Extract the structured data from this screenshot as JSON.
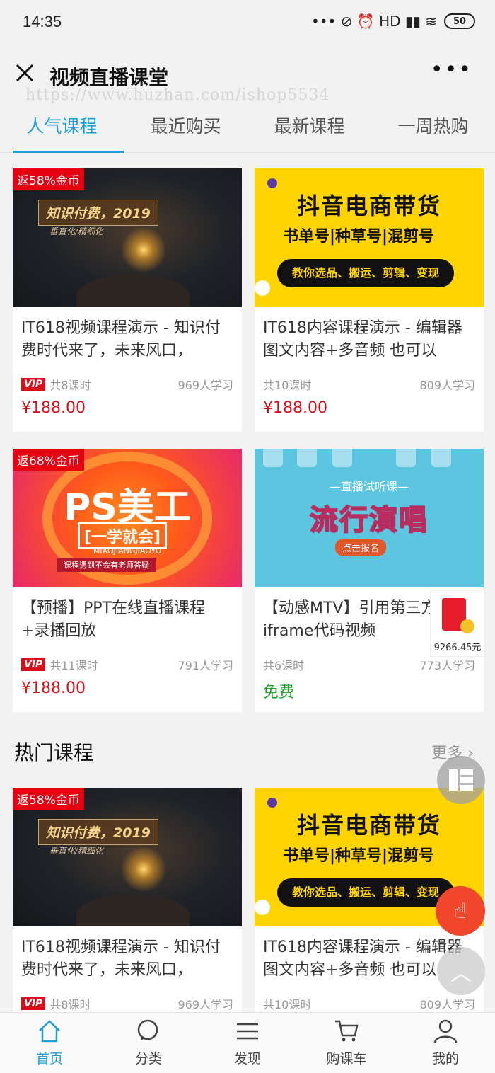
{
  "status_bar": {
    "time": "14:35",
    "icons_text": "••• ⊘ ⏰ HD ▮▮ ≋",
    "battery": "50"
  },
  "header": {
    "title": "视频直播课堂",
    "watermark": "https://www.huzhan.com/ishop5534"
  },
  "tabs": [
    {
      "label": "人气课程",
      "active": true
    },
    {
      "label": "最近购买",
      "active": false
    },
    {
      "label": "最新课程",
      "active": false
    },
    {
      "label": "一周热购",
      "active": false
    }
  ],
  "popular": [
    {
      "badge": "返58%金币",
      "thumb": {
        "banner": "知识付费，2019",
        "sub": "垂直化/精细化"
      },
      "title": "IT618视频课程演示 - 知识付费时代来了，未来风口，",
      "vip": "VIP",
      "lessons": "共8课时",
      "students": "969人学习",
      "price": "¥188.00"
    },
    {
      "badge": "",
      "thumb": {
        "line1": "抖音电商带货",
        "line2": "书单号|种草号|混剪号",
        "line3": "教你选品、搬运、剪辑、变现"
      },
      "title": "IT618内容课程演示 - 编辑器图文内容+多音频 也可以",
      "vip": "",
      "lessons": "共10课时",
      "students": "809人学习",
      "price": "¥188.00"
    },
    {
      "badge": "返68%金币",
      "thumb": {
        "line1": "PS美工",
        "line2": "[一学就会]",
        "line3": "MIAOJIANGJIAOYU",
        "line4": "课程遇到不会有老师答疑"
      },
      "title": "【预播】PPT在线直播课程+录播回放",
      "vip": "VIP",
      "lessons": "共11课时",
      "students": "791人学习",
      "price": "¥188.00"
    },
    {
      "badge": "",
      "thumb": {
        "line1": "—直播试听课—",
        "line2": "流行演唱",
        "line3": "点击报名"
      },
      "title": "【动感MTV】引用第三方通用iframe代码视频",
      "vip": "",
      "lessons": "共6课时",
      "students": "773人学习",
      "price": "免费"
    }
  ],
  "hot_section": {
    "title": "热门课程",
    "more": "更多 ›"
  },
  "hot": [
    {
      "badge": "返58%金币",
      "thumb": {
        "banner": "知识付费，2019",
        "sub": "垂直化/精细化"
      },
      "title": "IT618视频课程演示 - 知识付费时代来了，未来风口，",
      "vip": "VIP",
      "lessons": "共8课时",
      "students": "969人学习"
    },
    {
      "badge": "",
      "thumb": {
        "line1": "抖音电商带货",
        "line2": "书单号|种草号|混剪号",
        "line3": "教你选品、搬运、剪辑、变现"
      },
      "title": "IT618内容课程演示 - 编辑器图文内容+多音频 也可以",
      "vip": "",
      "lessons": "共10课时",
      "students": "809人学习"
    }
  ],
  "floating": {
    "redpacket_value": "9266.45元"
  },
  "bottom_nav": [
    {
      "label": "首页",
      "icon": "home-icon",
      "active": true
    },
    {
      "label": "分类",
      "icon": "search-icon",
      "active": false
    },
    {
      "label": "发现",
      "icon": "list-icon",
      "active": false
    },
    {
      "label": "购课车",
      "icon": "cart-icon",
      "active": false
    },
    {
      "label": "我的",
      "icon": "user-icon",
      "active": false
    }
  ],
  "colors": {
    "accent": "#1f9fd6",
    "price": "#d8101a",
    "free": "#24a12b",
    "badge": "#e60012"
  }
}
